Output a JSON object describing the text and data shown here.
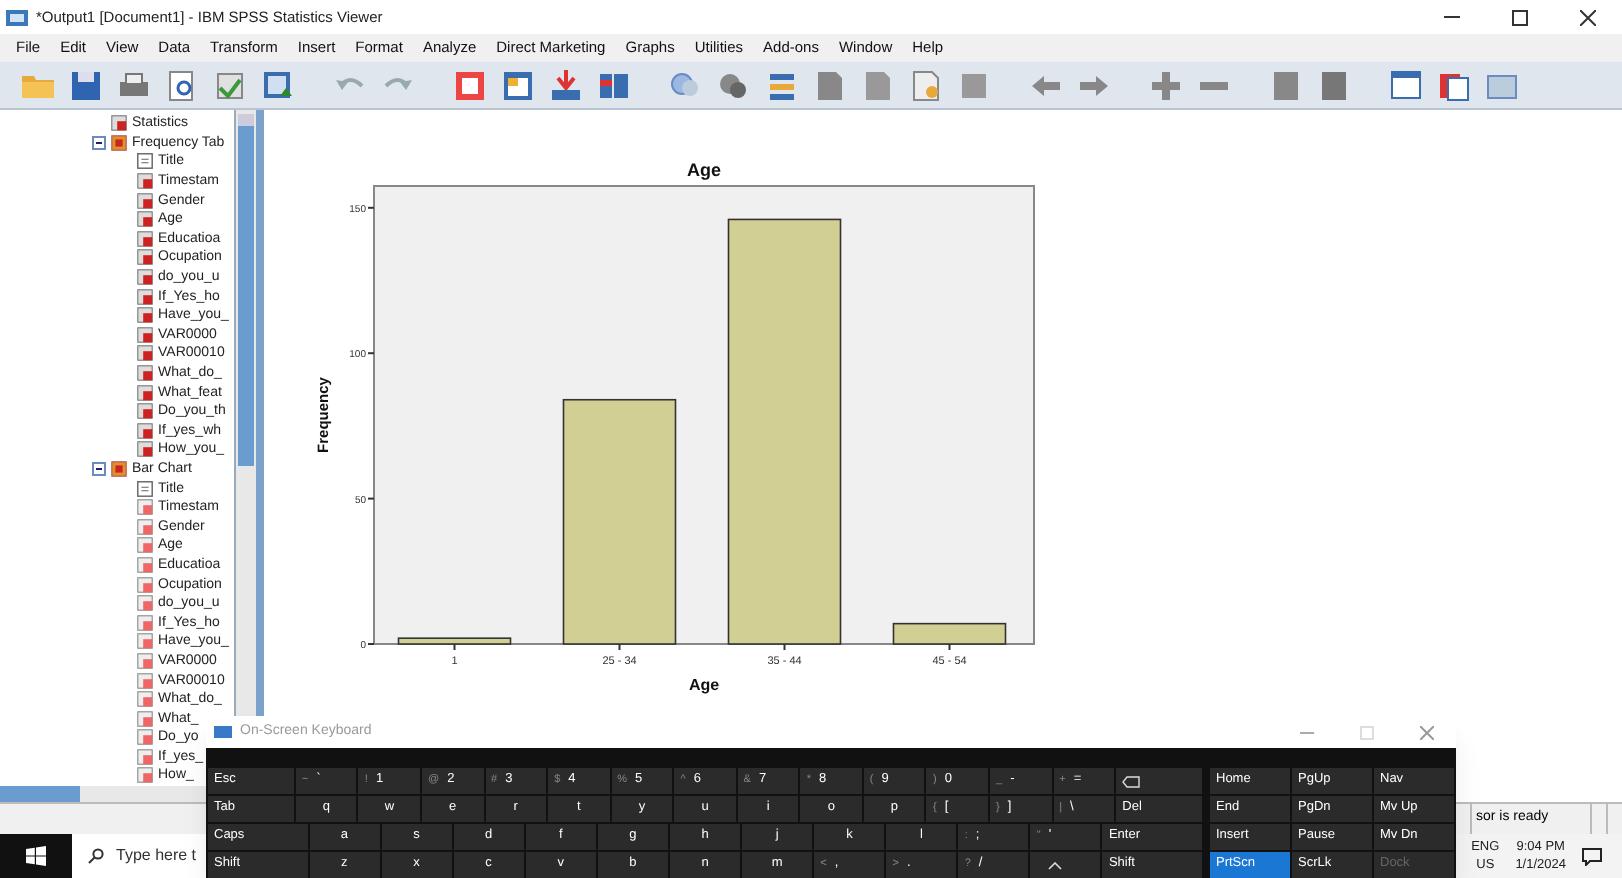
{
  "window": {
    "title": "*Output1 [Document1] - IBM SPSS Statistics Viewer"
  },
  "menu": [
    "File",
    "Edit",
    "View",
    "Data",
    "Transform",
    "Insert",
    "Format",
    "Analyze",
    "Direct Marketing",
    "Graphs",
    "Utilities",
    "Add-ons",
    "Window",
    "Help"
  ],
  "outline": [
    {
      "label": "Statistics",
      "kind": "table"
    },
    {
      "label": "Frequency Tab",
      "kind": "heading",
      "expanded": true,
      "children": [
        {
          "label": "Title",
          "kind": "title"
        },
        {
          "label": "Timestam",
          "kind": "table"
        },
        {
          "label": "Gender",
          "kind": "table"
        },
        {
          "label": "Age",
          "kind": "table"
        },
        {
          "label": "Educatioa",
          "kind": "table"
        },
        {
          "label": "Ocupation",
          "kind": "table"
        },
        {
          "label": "do_you_u",
          "kind": "table"
        },
        {
          "label": "If_Yes_ho",
          "kind": "table"
        },
        {
          "label": "Have_you_",
          "kind": "table"
        },
        {
          "label": "VAR0000",
          "kind": "table"
        },
        {
          "label": "VAR00010",
          "kind": "table"
        },
        {
          "label": "What_do_",
          "kind": "table"
        },
        {
          "label": "What_feat",
          "kind": "table"
        },
        {
          "label": "Do_you_th",
          "kind": "table"
        },
        {
          "label": "If_yes_wh",
          "kind": "table"
        },
        {
          "label": "How_you_",
          "kind": "table"
        }
      ]
    },
    {
      "label": "Bar Chart",
      "kind": "heading",
      "expanded": true,
      "children": [
        {
          "label": "Title",
          "kind": "title"
        },
        {
          "label": "Timestam",
          "kind": "chart"
        },
        {
          "label": "Gender",
          "kind": "chart"
        },
        {
          "label": "Age",
          "kind": "chart"
        },
        {
          "label": "Educatioa",
          "kind": "chart"
        },
        {
          "label": "Ocupation",
          "kind": "chart"
        },
        {
          "label": "do_you_u",
          "kind": "chart"
        },
        {
          "label": "If_Yes_ho",
          "kind": "chart"
        },
        {
          "label": "Have_you_",
          "kind": "chart"
        },
        {
          "label": "VAR0000",
          "kind": "chart"
        },
        {
          "label": "VAR00010",
          "kind": "chart"
        },
        {
          "label": "What_do_",
          "kind": "chart"
        },
        {
          "label": "What_",
          "kind": "chart"
        },
        {
          "label": "Do_yo",
          "kind": "chart"
        },
        {
          "label": "If_yes_",
          "kind": "chart"
        },
        {
          "label": "How_",
          "kind": "chart"
        }
      ]
    }
  ],
  "chart_data": {
    "type": "bar",
    "title": "Age",
    "xlabel": "Age",
    "ylabel": "Frequency",
    "categories": [
      "1",
      "25 - 34",
      "35 - 44",
      "45 - 54"
    ],
    "series": [
      {
        "color": "#d2cf94",
        "values": [
          2,
          84,
          146,
          7
        ]
      }
    ],
    "ylim": [
      0,
      157.5
    ],
    "yticks": [
      0,
      50,
      100,
      150
    ]
  },
  "keyboard": {
    "title": "On-Screen Keyboard",
    "rows": [
      {
        "keys": [
          {
            "label": "Esc",
            "kind": "wide"
          },
          {
            "label": "`",
            "shift": "~"
          },
          {
            "label": "1",
            "shift": "!"
          },
          {
            "label": "2",
            "shift": "@"
          },
          {
            "label": "3",
            "shift": "#"
          },
          {
            "label": "4",
            "shift": "$"
          },
          {
            "label": "5",
            "shift": "%"
          },
          {
            "label": "6",
            "shift": "^"
          },
          {
            "label": "7",
            "shift": "&"
          },
          {
            "label": "8",
            "shift": "*"
          },
          {
            "label": "9",
            "shift": "("
          },
          {
            "label": "0",
            "shift": ")"
          },
          {
            "label": "-",
            "shift": "_"
          },
          {
            "label": "=",
            "shift": "+"
          },
          {
            "kind": "backspace"
          }
        ]
      },
      {
        "keys": [
          {
            "label": "Tab",
            "kind": "wide"
          },
          {
            "label": "q"
          },
          {
            "label": "w"
          },
          {
            "label": "e"
          },
          {
            "label": "r"
          },
          {
            "label": "t"
          },
          {
            "label": "y"
          },
          {
            "label": "u"
          },
          {
            "label": "i"
          },
          {
            "label": "o"
          },
          {
            "label": "p"
          },
          {
            "label": "[",
            "shift": "{"
          },
          {
            "label": "]",
            "shift": "}"
          },
          {
            "label": "\\",
            "shift": "|"
          },
          {
            "label": "Del",
            "kind": "wide"
          }
        ]
      },
      {
        "keys": [
          {
            "label": "Caps",
            "kind": "wide"
          },
          {
            "label": "a"
          },
          {
            "label": "s"
          },
          {
            "label": "d"
          },
          {
            "label": "f"
          },
          {
            "label": "g"
          },
          {
            "label": "h"
          },
          {
            "label": "j"
          },
          {
            "label": "k"
          },
          {
            "label": "l"
          },
          {
            "label": ";",
            "shift": ":"
          },
          {
            "label": "'",
            "shift": "\""
          },
          {
            "label": "Enter",
            "kind": "wide"
          }
        ]
      },
      {
        "keys": [
          {
            "label": "Shift",
            "kind": "wide"
          },
          {
            "label": "z"
          },
          {
            "label": "x"
          },
          {
            "label": "c"
          },
          {
            "label": "v"
          },
          {
            "label": "b"
          },
          {
            "label": "n"
          },
          {
            "label": "m"
          },
          {
            "label": ",",
            "shift": "<"
          },
          {
            "label": ".",
            "shift": ">"
          },
          {
            "label": "/",
            "shift": "?"
          },
          {
            "kind": "arrow-up"
          },
          {
            "label": "Shift",
            "kind": "wide"
          }
        ]
      }
    ],
    "nav_rows": [
      {
        "keys": [
          {
            "label": "Home",
            "pressed": false,
            "disabled": false
          },
          {
            "label": "PgUp",
            "pressed": false,
            "disabled": false
          },
          {
            "label": "Nav",
            "pressed": false,
            "disabled": false
          }
        ]
      },
      {
        "keys": [
          {
            "label": "End",
            "pressed": false,
            "disabled": false
          },
          {
            "label": "PgDn",
            "pressed": false,
            "disabled": false
          },
          {
            "label": "Mv Up",
            "pressed": false,
            "disabled": false
          }
        ]
      },
      {
        "keys": [
          {
            "label": "Insert",
            "pressed": false,
            "disabled": false
          },
          {
            "label": "Pause",
            "pressed": false,
            "disabled": false
          },
          {
            "label": "Mv Dn",
            "pressed": false,
            "disabled": false
          }
        ]
      },
      {
        "keys": [
          {
            "label": "PrtScn",
            "pressed": true,
            "disabled": false
          },
          {
            "label": "ScrLk",
            "pressed": false,
            "disabled": false
          },
          {
            "label": "Dock",
            "pressed": false,
            "disabled": true
          }
        ]
      }
    ]
  },
  "status_bar": {
    "text": "sor is ready"
  },
  "taskbar": {
    "search_placeholder": "Type here t",
    "language": "ENG",
    "region": "US",
    "time": "9:04 PM",
    "date": "1/1/2024"
  }
}
